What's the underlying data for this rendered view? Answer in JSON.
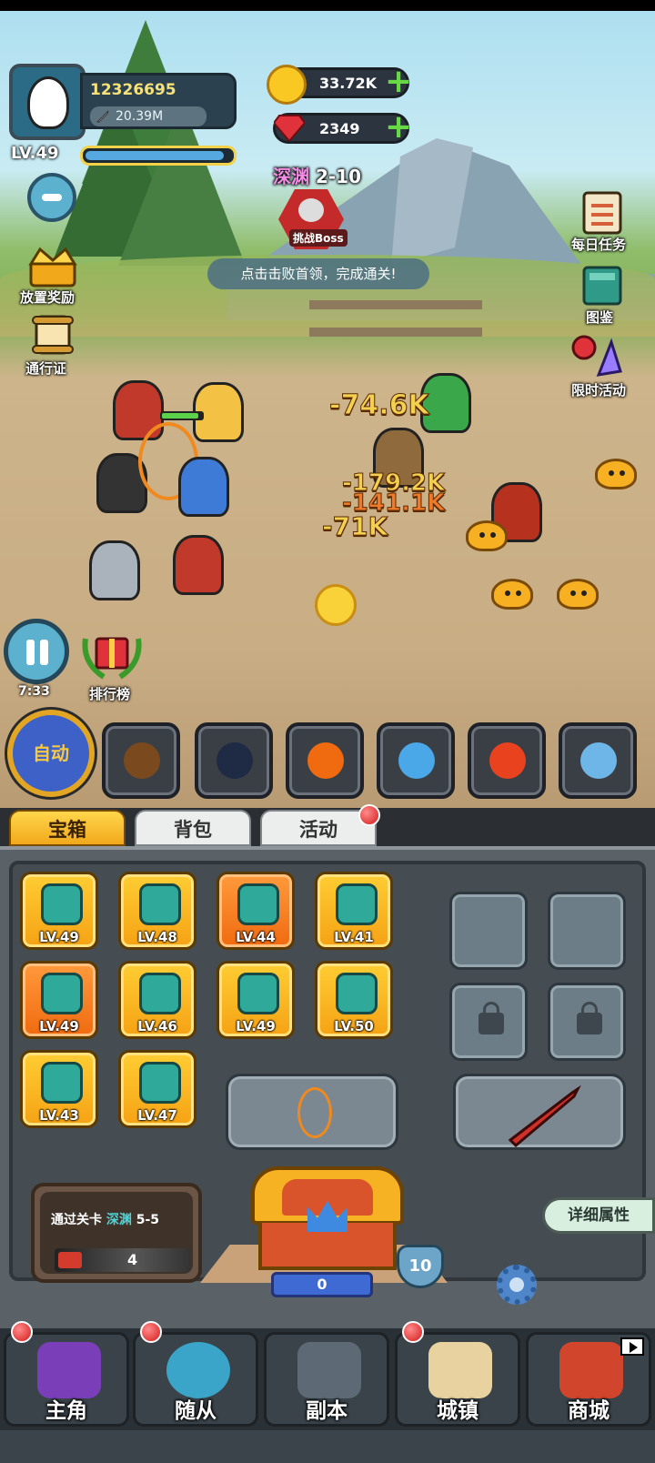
{
  "player": {
    "power": "12326695",
    "sub_power": "20.39M",
    "level": "LV.49",
    "xp_fraction": 0.95
  },
  "currency": {
    "gold": "33.72K",
    "gems": "2349"
  },
  "stage": {
    "zone": "深渊",
    "number": "2-10",
    "boss_button": "挑战Boss",
    "hint": "点击击败首领，完成通关!"
  },
  "left_menu": {
    "idle_reward": "放置奖励",
    "pass": "通行证"
  },
  "right_menu": {
    "daily_tasks": "每日任务",
    "codex": "图鉴",
    "limited_event": "限时活动"
  },
  "battle": {
    "damage_numbers": [
      "-74.6K",
      "-179.2K",
      "-141.1K",
      "-71K"
    ],
    "timer": "7:33",
    "ranking": "排行榜"
  },
  "skills": {
    "auto_label": "自动",
    "icons": [
      "bomb-barrel-icon",
      "skull-bomb-icon",
      "fireball-icon",
      "ghost-icon",
      "flame-icon",
      "feather-blade-icon"
    ]
  },
  "tabs": {
    "chest": "宝箱",
    "backpack": "背包",
    "activity": "活动"
  },
  "equipment": {
    "items": [
      {
        "icon": "axe-icon",
        "level": "LV.49",
        "rarity": "gold"
      },
      {
        "icon": "helmet-icon",
        "level": "LV.48",
        "rarity": "gold"
      },
      {
        "icon": "chest-armor-icon",
        "level": "LV.44",
        "rarity": "orange"
      },
      {
        "icon": "amulet-icon",
        "level": "LV.41",
        "rarity": "gold"
      },
      {
        "icon": "ring-icon",
        "level": "LV.49",
        "rarity": "orange"
      },
      {
        "icon": "spear-icon",
        "level": "LV.46",
        "rarity": "gold"
      },
      {
        "icon": "crossbow-icon",
        "level": "LV.49",
        "rarity": "gold"
      },
      {
        "icon": "shield-icon",
        "level": "LV.50",
        "rarity": "gold"
      },
      {
        "icon": "boots-icon",
        "level": "LV.43",
        "rarity": "gold"
      },
      {
        "icon": "gauntlet-icon",
        "level": "LV.47",
        "rarity": "gold"
      }
    ]
  },
  "stage_card": {
    "prefix": "通过关卡",
    "zone": "深渊",
    "number": "5-5",
    "ticket_count": "4"
  },
  "chest": {
    "count": "0",
    "level": "10"
  },
  "detail_button": "详细属性",
  "bottom_nav": {
    "hero": "主角",
    "follower": "随从",
    "dungeon": "副本",
    "town": "城镇",
    "shop": "商城"
  }
}
